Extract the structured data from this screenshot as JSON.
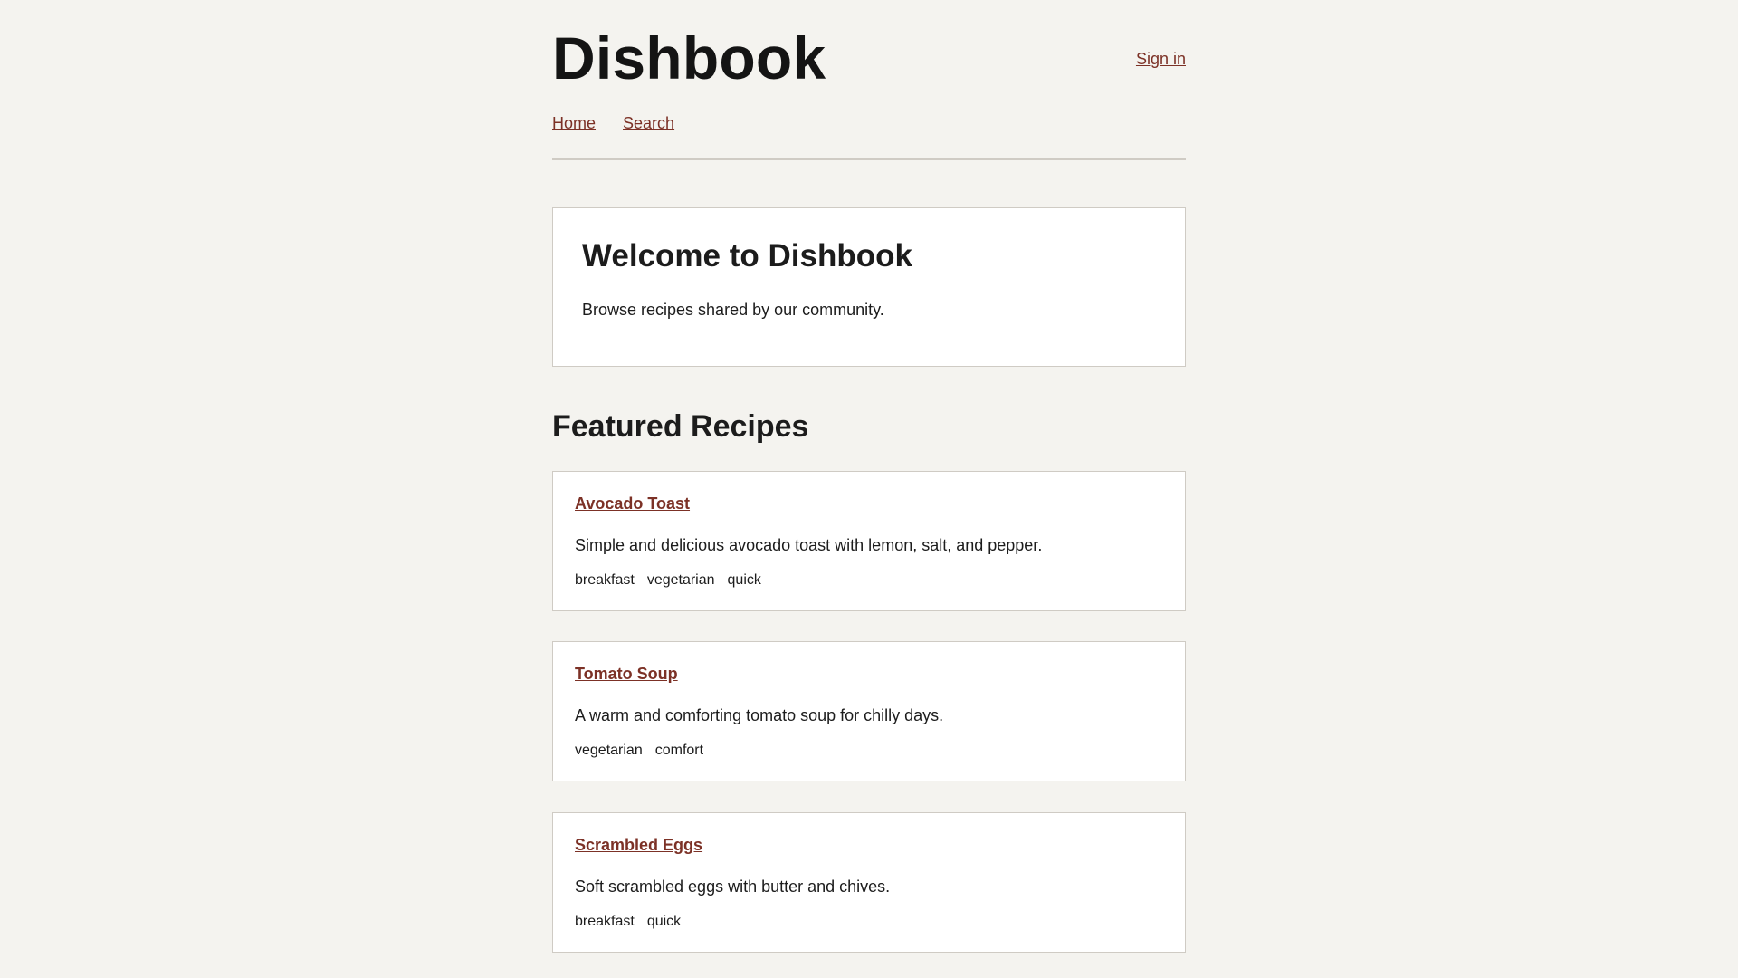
{
  "site": {
    "title": "Dishbook",
    "signin_label": "Sign in"
  },
  "nav": {
    "items": [
      {
        "label": "Home"
      },
      {
        "label": "Search"
      }
    ]
  },
  "welcome": {
    "heading": "Welcome to Dishbook",
    "text": "Browse recipes shared by our community."
  },
  "featured": {
    "heading": "Featured Recipes",
    "recipes": [
      {
        "title": "Avocado Toast",
        "description": "Simple and delicious avocado toast with lemon, salt, and pepper.",
        "tags": [
          "breakfast",
          "vegetarian",
          "quick"
        ]
      },
      {
        "title": "Tomato Soup",
        "description": "A warm and comforting tomato soup for chilly days.",
        "tags": [
          "vegetarian",
          "comfort"
        ]
      },
      {
        "title": "Scrambled Eggs",
        "description": "Soft scrambled eggs with butter and chives.",
        "tags": [
          "breakfast",
          "quick"
        ]
      }
    ]
  },
  "colors": {
    "background": "#f4f3ef",
    "link": "#7c3126",
    "border": "#cfcbc4"
  }
}
